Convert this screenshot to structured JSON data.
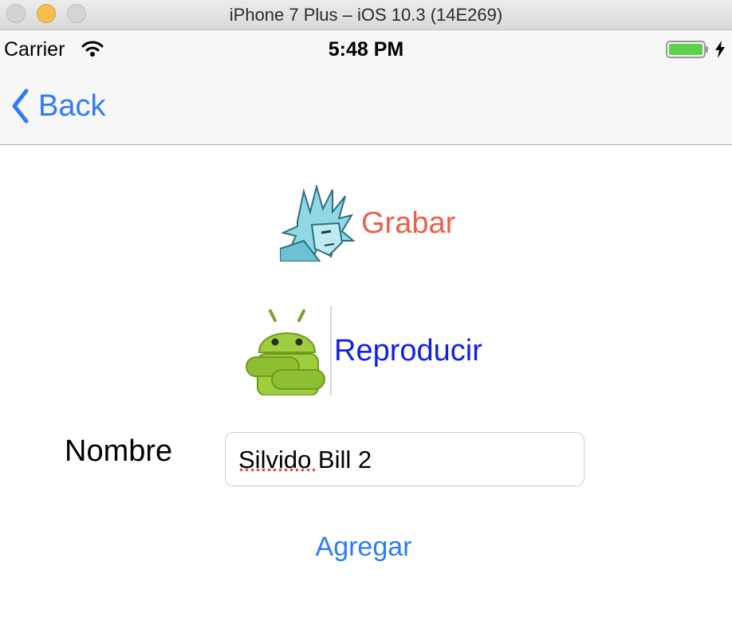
{
  "window": {
    "title": "iPhone 7 Plus – iOS 10.3 (14E269)"
  },
  "status_bar": {
    "carrier": "Carrier",
    "time": "5:48 PM",
    "battery_color": "#5ed14c"
  },
  "nav": {
    "back_label": "Back",
    "tint": "#2f7cf6"
  },
  "actions": {
    "record_label": "Grabar",
    "record_color": "#e8604c",
    "play_label": "Reproducir",
    "play_color": "#1020e8"
  },
  "form": {
    "name_label": "Nombre",
    "name_value": "Silvido Bill 2",
    "add_label": "Agregar"
  }
}
